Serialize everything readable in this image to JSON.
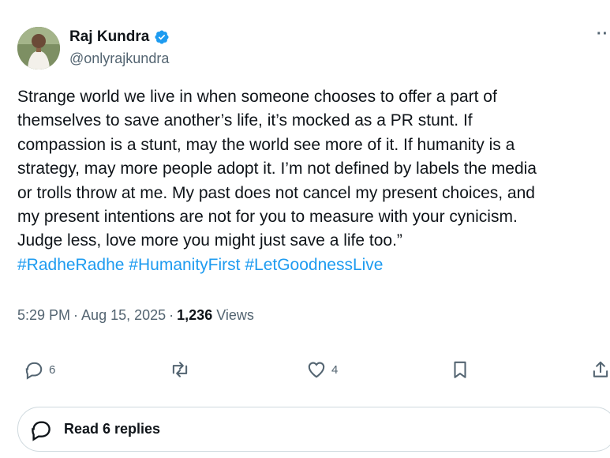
{
  "author": {
    "name": "Raj Kundra",
    "handle": "@onlyrajkundra",
    "verified": true
  },
  "tweet": {
    "lines": [
      "Strange world we live in when someone chooses to offer a part of",
      "themselves to save another’s life, it’s mocked as a PR stunt. If",
      "compassion is a stunt, may the world see more of it. If humanity is a",
      "strategy, may more people adopt it. I’m not defined by labels the media",
      "or trolls throw at me. My past does not cancel my present choices, and",
      "my present intentions are not for you to measure with your cynicism.",
      "Judge less, love more you might just save a life too.”"
    ],
    "hashtags": [
      "#RadheRadhe",
      "#HumanityFirst",
      "#LetGoodnessLive"
    ]
  },
  "meta": {
    "time": "5:29 PM",
    "separator": "·",
    "date": "Aug 15, 2025",
    "views_count": "1,236",
    "views_label": "Views"
  },
  "actions": {
    "reply_count": "6",
    "like_count": "4"
  },
  "read_replies": {
    "label": "Read 6 replies"
  },
  "colors": {
    "text": "#0f1419",
    "secondary": "#536471",
    "accent": "#1d9bf0",
    "border": "#cfd9de"
  }
}
